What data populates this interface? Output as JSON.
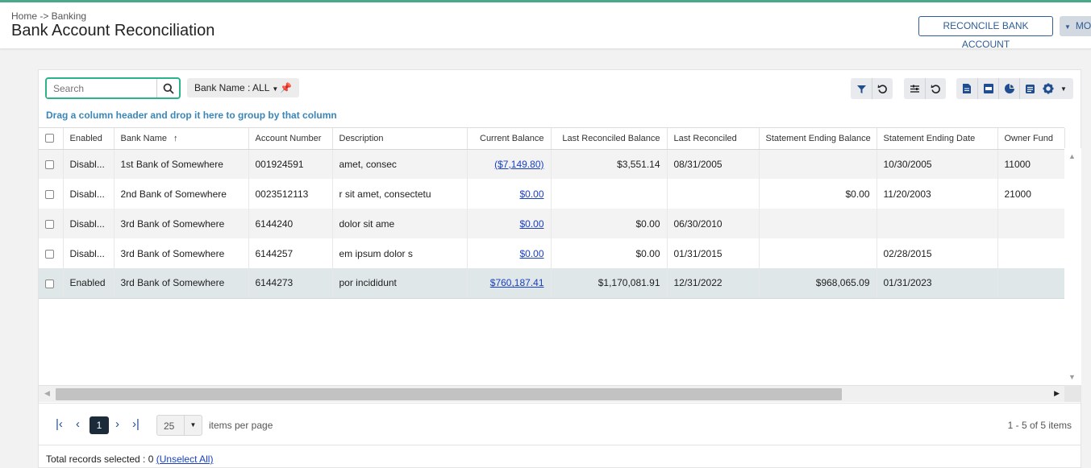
{
  "header": {
    "breadcrumb": "Home -> Banking",
    "title": "Bank Account Reconciliation",
    "reconcile_label": "RECONCILE BANK ACCOUNT",
    "more_label": "MO"
  },
  "toolbar": {
    "search_placeholder": "Search",
    "filter_chip": "Bank Name : ALL",
    "group_hint": "Drag a column header and drop it here to group by that column",
    "icons": [
      "filter-icon",
      "reset-icon",
      "columns-icon",
      "reset-icon",
      "document-icon",
      "pdf-icon",
      "chart-icon",
      "list-icon",
      "gear-icon"
    ]
  },
  "grid": {
    "columns": [
      "",
      "Enabled",
      "Bank Name",
      "Account Number",
      "Description",
      "Current Balance",
      "Last Reconciled Balance",
      "Last Reconciled",
      "Statement Ending Balance",
      "Statement Ending Date",
      "Owner Fund"
    ],
    "sorted_column": "Bank Name",
    "rows": [
      {
        "enabled": "Disabl...",
        "bank": "1st Bank of Somewhere",
        "account": "001924591",
        "desc": "amet, consec",
        "current": "($7,149.80)",
        "last_bal": "$3,551.14",
        "last_rec": "08/31/2005",
        "stmt_bal": "",
        "stmt_date": "10/30/2005",
        "fund": "11000"
      },
      {
        "enabled": "Disabl...",
        "bank": "2nd Bank of Somewhere",
        "account": "0023512113",
        "desc": "r sit amet, consectetu",
        "current": "$0.00",
        "last_bal": "",
        "last_rec": "",
        "stmt_bal": "$0.00",
        "stmt_date": "11/20/2003",
        "fund": "21000"
      },
      {
        "enabled": "Disabl...",
        "bank": "3rd Bank of Somewhere",
        "account": "6144240",
        "desc": "dolor sit ame",
        "current": "$0.00",
        "last_bal": "$0.00",
        "last_rec": "06/30/2010",
        "stmt_bal": "",
        "stmt_date": "",
        "fund": ""
      },
      {
        "enabled": "Disabl...",
        "bank": "3rd Bank of Somewhere",
        "account": "6144257",
        "desc": "em ipsum dolor s",
        "current": "$0.00",
        "last_bal": "$0.00",
        "last_rec": "01/31/2015",
        "stmt_bal": "",
        "stmt_date": "02/28/2015",
        "fund": ""
      },
      {
        "enabled": "Enabled",
        "bank": "3rd Bank of Somewhere",
        "account": "6144273",
        "desc": "por incididunt",
        "current": "$760,187.41",
        "last_bal": "$1,170,081.91",
        "last_rec": "12/31/2022",
        "stmt_bal": "$968,065.09",
        "stmt_date": "01/31/2023",
        "fund": ""
      }
    ]
  },
  "pager": {
    "current_page": "1",
    "page_size": "25",
    "items_label": "items per page",
    "info": "1 - 5 of 5 items"
  },
  "footer": {
    "selected_text": "Total records selected : 0",
    "unselect_label": "(Unselect All)"
  }
}
